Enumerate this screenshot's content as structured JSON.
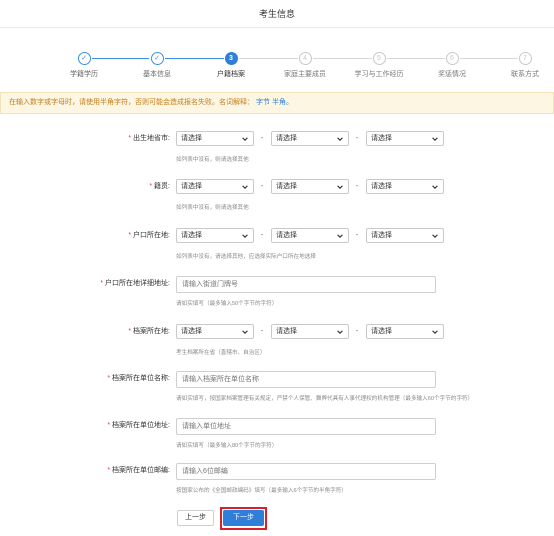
{
  "page": {
    "title": "考生信息"
  },
  "steps": [
    {
      "num": "✓",
      "label": "学籍学历",
      "state": "done"
    },
    {
      "num": "✓",
      "label": "基本信息",
      "state": "done"
    },
    {
      "num": "3",
      "label": "户籍档案",
      "state": "active"
    },
    {
      "num": "4",
      "label": "家庭主要成员",
      "state": "todo"
    },
    {
      "num": "5",
      "label": "学习与工作经历",
      "state": "todo"
    },
    {
      "num": "6",
      "label": "奖惩情况",
      "state": "todo"
    },
    {
      "num": "7",
      "label": "联系方式",
      "state": "todo"
    }
  ],
  "notice": {
    "text": "在输入数字或字母时，请使用半角字符，否则可能会造成报名失败。名词解释：",
    "link": "字节 半角。"
  },
  "form": {
    "birthplace": {
      "label": "出生地省市:",
      "select1": "请选择",
      "select2": "请选择",
      "select3": "请选择",
      "hint": "如列表中没有，则请选择其他"
    },
    "native": {
      "label": "籍贯:",
      "select1": "请选择",
      "select2": "请选择",
      "select3": "请选择",
      "hint": "如列表中没有，则请选择其他"
    },
    "hukou": {
      "label": "户口所在地:",
      "select1": "请选择",
      "select2": "请选择",
      "select3": "请选择",
      "hint": "如列表中没有，请选择其他，应选择实际户口所在地选择"
    },
    "hukou_address": {
      "label": "户口所在地详细地址:",
      "placeholder": "请输入街道门牌号",
      "hint": "请如实填写（最多输入50个字节的字符）"
    },
    "archive_location": {
      "label": "档案所在地:",
      "select1": "请选择",
      "select2": "请选择",
      "select3": "请选择",
      "hint": "考生档案所在省（直辖市、自治区）"
    },
    "archive_unit_name": {
      "label": "档案所在单位名称:",
      "placeholder": "请输入档案所在单位名称",
      "hint": "请如实填写，按国家档案管理有关规定，严禁个人保管、舞弊代具有人事代理权的机构管理（最多输入60个字节的字符）"
    },
    "archive_unit_address": {
      "label": "档案所在单位地址:",
      "placeholder": "请输入单位地址",
      "hint": "请如实填写（最多输入80个字节的字符）"
    },
    "archive_postcode": {
      "label": "档案所在单位邮编:",
      "placeholder": "请输入6位邮编",
      "hint": "按国家公布的《全国邮政编码》填写（最多输入6个字节的半角字符）"
    }
  },
  "buttons": {
    "prev": "上一步",
    "next": "下一步"
  },
  "colors": {
    "primary": "#2f7fd8",
    "required": "#e53935",
    "notice_bg": "#fdf6e3",
    "notice_text": "#c57d1b",
    "highlight": "#d9202a"
  }
}
